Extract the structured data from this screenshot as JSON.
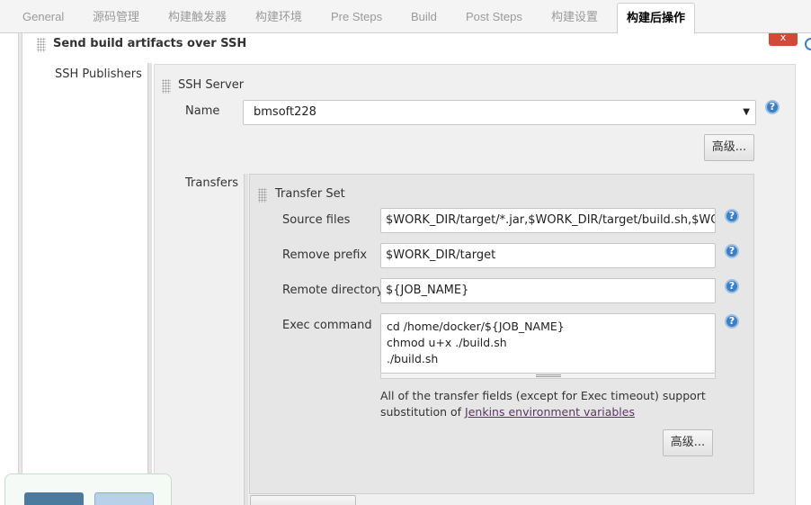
{
  "tabs": [
    {
      "label": "General"
    },
    {
      "label": "源码管理"
    },
    {
      "label": "构建触发器"
    },
    {
      "label": "构建环境"
    },
    {
      "label": "Pre Steps"
    },
    {
      "label": "Build"
    },
    {
      "label": "Post Steps"
    },
    {
      "label": "构建设置"
    },
    {
      "label": "构建后操作"
    }
  ],
  "section": {
    "title": "Send build artifacts over SSH",
    "close_label": "x",
    "publishers_label": "SSH Publishers"
  },
  "server": {
    "title": "SSH Server",
    "name_label": "Name",
    "name_value": "bmsoft228",
    "advanced_label": "高级..."
  },
  "transfers": {
    "label": "Transfers",
    "set_title": "Transfer Set",
    "source_label": "Source files",
    "source_value": "$WORK_DIR/target/*.jar,$WORK_DIR/target/build.sh,$WORK_",
    "prefix_label": "Remove prefix",
    "prefix_value": "$WORK_DIR/target",
    "remote_label": "Remote directory",
    "remote_value": "${JOB_NAME}",
    "exec_label": "Exec command",
    "exec_value": "cd /home/docker/${JOB_NAME}\nchmod u+x ./build.sh\n./build.sh",
    "note_text": "All of the transfer fields (except for Exec timeout) support substitution of ",
    "note_link": "Jenkins environment variables",
    "advanced_label": "高级..."
  },
  "help_glyph": "?",
  "icons": {
    "help": "question-circle-icon",
    "grip": "drag-handle-icon",
    "close": "close-icon",
    "dropdown": "chevron-down-icon"
  }
}
